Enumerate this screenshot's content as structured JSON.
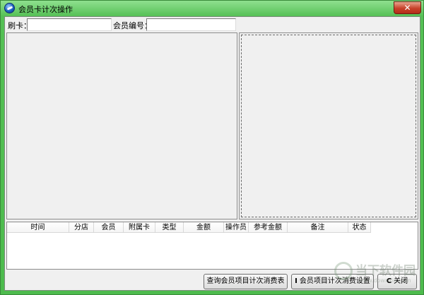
{
  "window": {
    "title": "会员卡计次操作",
    "close_glyph": "✕"
  },
  "form": {
    "card_label": "刷卡：",
    "card_value": "",
    "member_no_label": "会员编号：",
    "member_no_value": ""
  },
  "table": {
    "columns": [
      "时间",
      "分店",
      "会员",
      "附属卡",
      "类型",
      "金额",
      "操作员",
      "参考金额",
      "备注",
      "状态"
    ],
    "rows": []
  },
  "buttons": {
    "query_label": "查询会员项目计次消费表",
    "settings_icon": "I",
    "settings_label": "会员项目计次消费设置",
    "close_icon": "C",
    "close_label": "关闭"
  },
  "watermark": {
    "text": "当下软件园",
    "sub": "www.downxia.com"
  }
}
